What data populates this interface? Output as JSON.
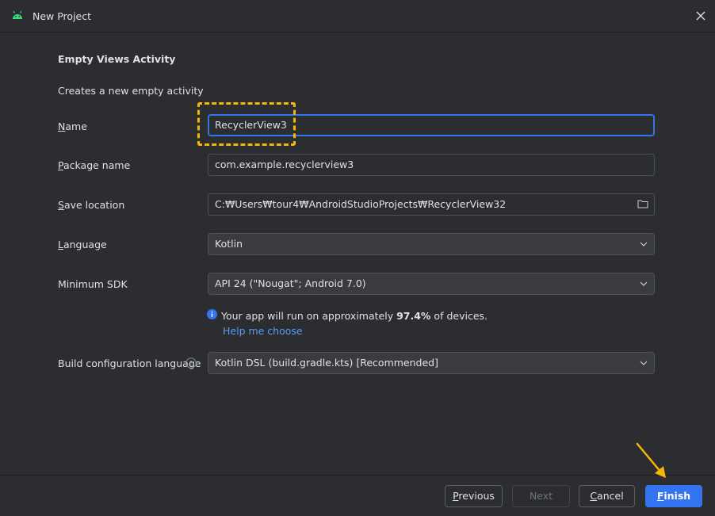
{
  "window": {
    "title": "New Project",
    "icon": "android-icon"
  },
  "header": {
    "heading": "Empty Views Activity",
    "description": "Creates a new empty activity"
  },
  "form": {
    "name": {
      "label_mnemonic": "N",
      "label_rest": "ame",
      "value": "RecyclerView3"
    },
    "package": {
      "label_mnemonic": "P",
      "label_rest": "ackage name",
      "value": "com.example.recyclerview3"
    },
    "save_location": {
      "label_mnemonic": "S",
      "label_rest": "ave location",
      "value": "C:₩Users₩tour4₩AndroidStudioProjects₩RecyclerView32",
      "icon": "folder-icon"
    },
    "language": {
      "label_mnemonic": "L",
      "label_rest": "anguage",
      "value": "Kotlin"
    },
    "min_sdk": {
      "label": "Minimum SDK",
      "value": "API 24 (\"Nougat\"; Android 7.0)"
    },
    "sdk_info": {
      "prefix": "Your app will run on approximately ",
      "percent": "97.4%",
      "suffix": " of devices.",
      "help_link": "Help me choose"
    },
    "build_language": {
      "label": "Build configuration language",
      "value": "Kotlin DSL (build.gradle.kts) [Recommended]"
    }
  },
  "footer": {
    "previous": {
      "mnemonic": "P",
      "rest": "revious"
    },
    "next": "Next",
    "cancel": {
      "mnemonic": "C",
      "rest": "ancel"
    },
    "finish": {
      "mnemonic": "F",
      "rest": "inish"
    }
  },
  "colors": {
    "background": "#2b2d30",
    "accent": "#3574f0",
    "link": "#589df6",
    "annotation": "#f5b800",
    "android_green": "#3ddc84"
  }
}
